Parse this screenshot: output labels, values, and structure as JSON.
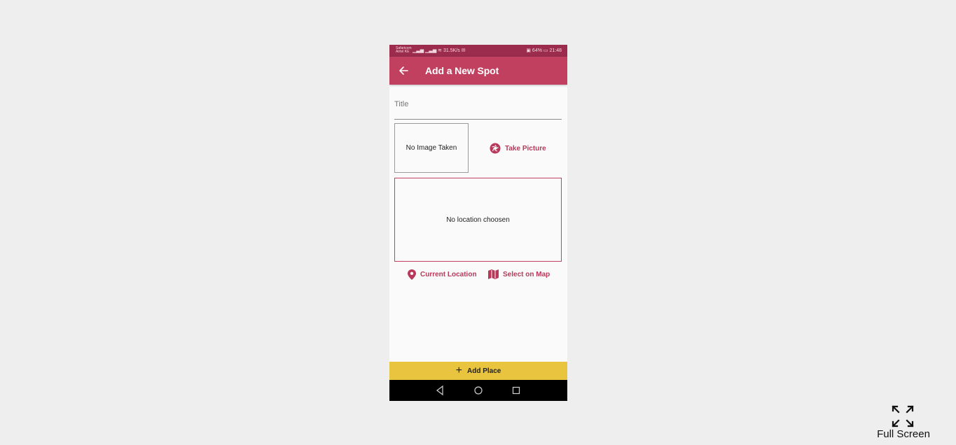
{
  "status_bar": {
    "carrier_line1": "Safaricom",
    "carrier_line2": "Airtel KE",
    "net_speed": "31.5K/s",
    "battery": "64%",
    "time": "21:48"
  },
  "app_bar": {
    "title": "Add a New Spot"
  },
  "form": {
    "title_placeholder": "Title",
    "title_value": ""
  },
  "image": {
    "placeholder_text": "No Image Taken",
    "take_picture_label": "Take Picture"
  },
  "location": {
    "placeholder_text": "No location choosen",
    "current_location_label": "Current Location",
    "select_on_map_label": "Select on Map"
  },
  "add_place_label": "Add Place",
  "fullscreen_label": "Full Screen",
  "colors": {
    "primary": "#c2405f",
    "primary_dark": "#9b2c4d",
    "accent": "#e8c43f",
    "background": "#fafafa",
    "page_background": "#eeeeee"
  }
}
